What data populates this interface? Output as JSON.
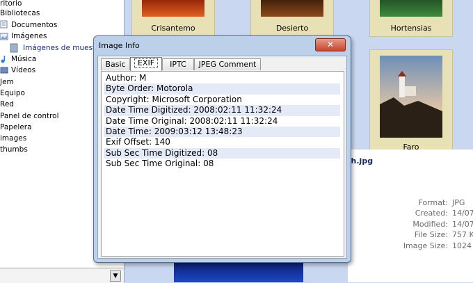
{
  "tree": {
    "items": [
      {
        "label": "ritorio",
        "indent": 0
      },
      {
        "label": "Bibliotecas",
        "indent": 0
      },
      {
        "label": "Documentos",
        "indent": 1
      },
      {
        "label": "Imágenes",
        "indent": 1
      },
      {
        "label": "Imágenes de muestra",
        "indent": 2
      },
      {
        "label": "Música",
        "indent": 1
      },
      {
        "label": "Vídeos",
        "indent": 1
      },
      {
        "label": "Jem",
        "indent": 0
      },
      {
        "label": "Equipo",
        "indent": 0
      },
      {
        "label": "Red",
        "indent": 0
      },
      {
        "label": "Panel de control",
        "indent": 0
      },
      {
        "label": "Papelera",
        "indent": 0
      },
      {
        "label": "images",
        "indent": 0
      },
      {
        "label": "thumbs",
        "indent": 0
      }
    ],
    "dropdown_arrow": "▼"
  },
  "gallery": {
    "thumbs": [
      {
        "label": "Crisantemo",
        "color": "#c43d12"
      },
      {
        "label": "Desierto",
        "color": "#7a3b12"
      },
      {
        "label": "Hortensias",
        "color": "#2f6a2f"
      },
      {
        "label": "Faro",
        "color": "#5b6b80"
      }
    ],
    "details": {
      "filename_fragment": "sh.jpg",
      "rows": [
        {
          "label": "Format:",
          "value": "JPG"
        },
        {
          "label": "Created:",
          "value": "14/07"
        },
        {
          "label": "Modified:",
          "value": "14/07"
        },
        {
          "label": "File Size:",
          "value": "757 K"
        },
        {
          "label": "Image Size:",
          "value": "1024"
        }
      ]
    }
  },
  "dialog": {
    "title": "Image Info",
    "close_glyph": "✕",
    "tabs": [
      "Basic",
      "EXIF",
      "IPTC",
      "JPEG Comment"
    ],
    "active_tab": "EXIF",
    "rows": [
      "Author: M",
      "Byte Order: Motorola",
      "Copyright: Microsoft Corporation",
      "Date Time Digitized: 2008:02:11 11:32:24",
      "Date Time Original: 2008:02:11 11:32:24",
      "Date Time: 2009:03:12 13:48:23",
      "Exif Offset: 140",
      "Sub Sec Time Digitized: 08",
      "Sub Sec Time Original: 08"
    ]
  }
}
